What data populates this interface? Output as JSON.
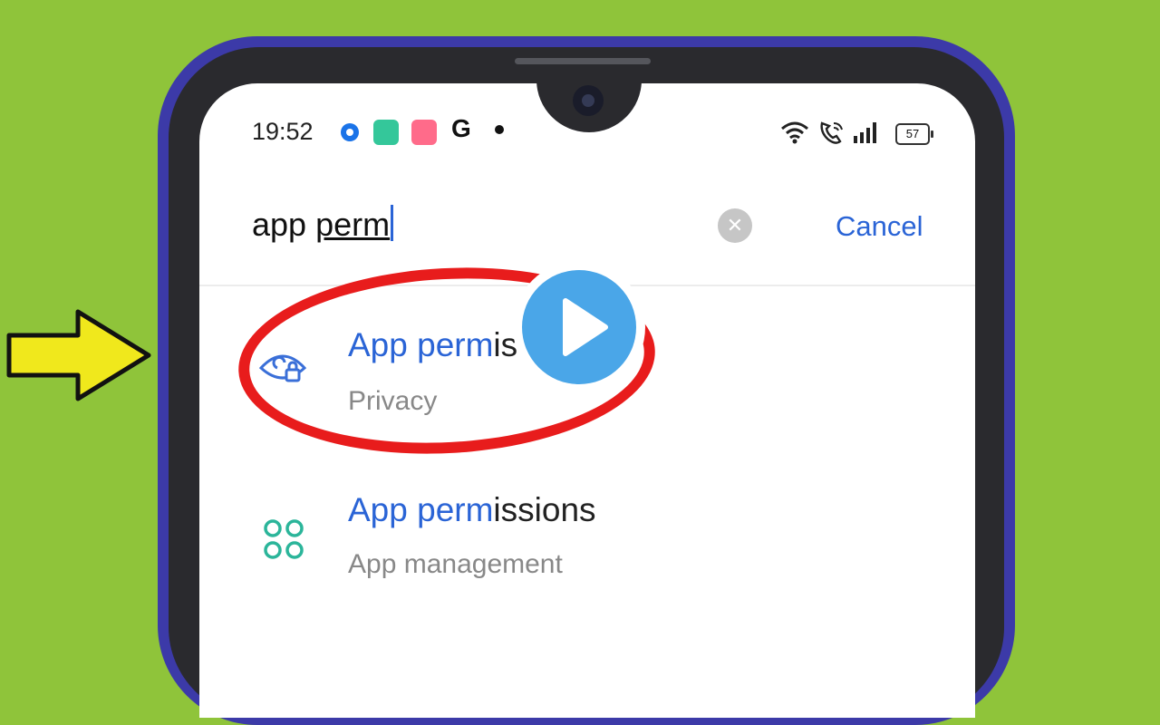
{
  "status_bar": {
    "time": "19:52",
    "google_letter": "G",
    "battery": "57",
    "icons": [
      "wifi-icon",
      "wifi-calling-icon",
      "signal-icon",
      "battery-icon"
    ]
  },
  "search": {
    "query_plain": "app ",
    "query_underlined": "perm",
    "cancel_label": "Cancel"
  },
  "results": [
    {
      "title_highlight": "App perm",
      "title_rest": "issions",
      "subtitle": "Privacy",
      "icon": "privacy-eye-lock-icon"
    },
    {
      "title_highlight": "App perm",
      "title_rest": "issions",
      "subtitle": "App management",
      "icon": "app-grid-icon"
    }
  ],
  "colors": {
    "background": "#8fc43a",
    "accent": "#2a64d6",
    "highlight_ring": "#e81c1c",
    "play_button": "#4aa6e8",
    "arrow": "#f0e81c"
  }
}
